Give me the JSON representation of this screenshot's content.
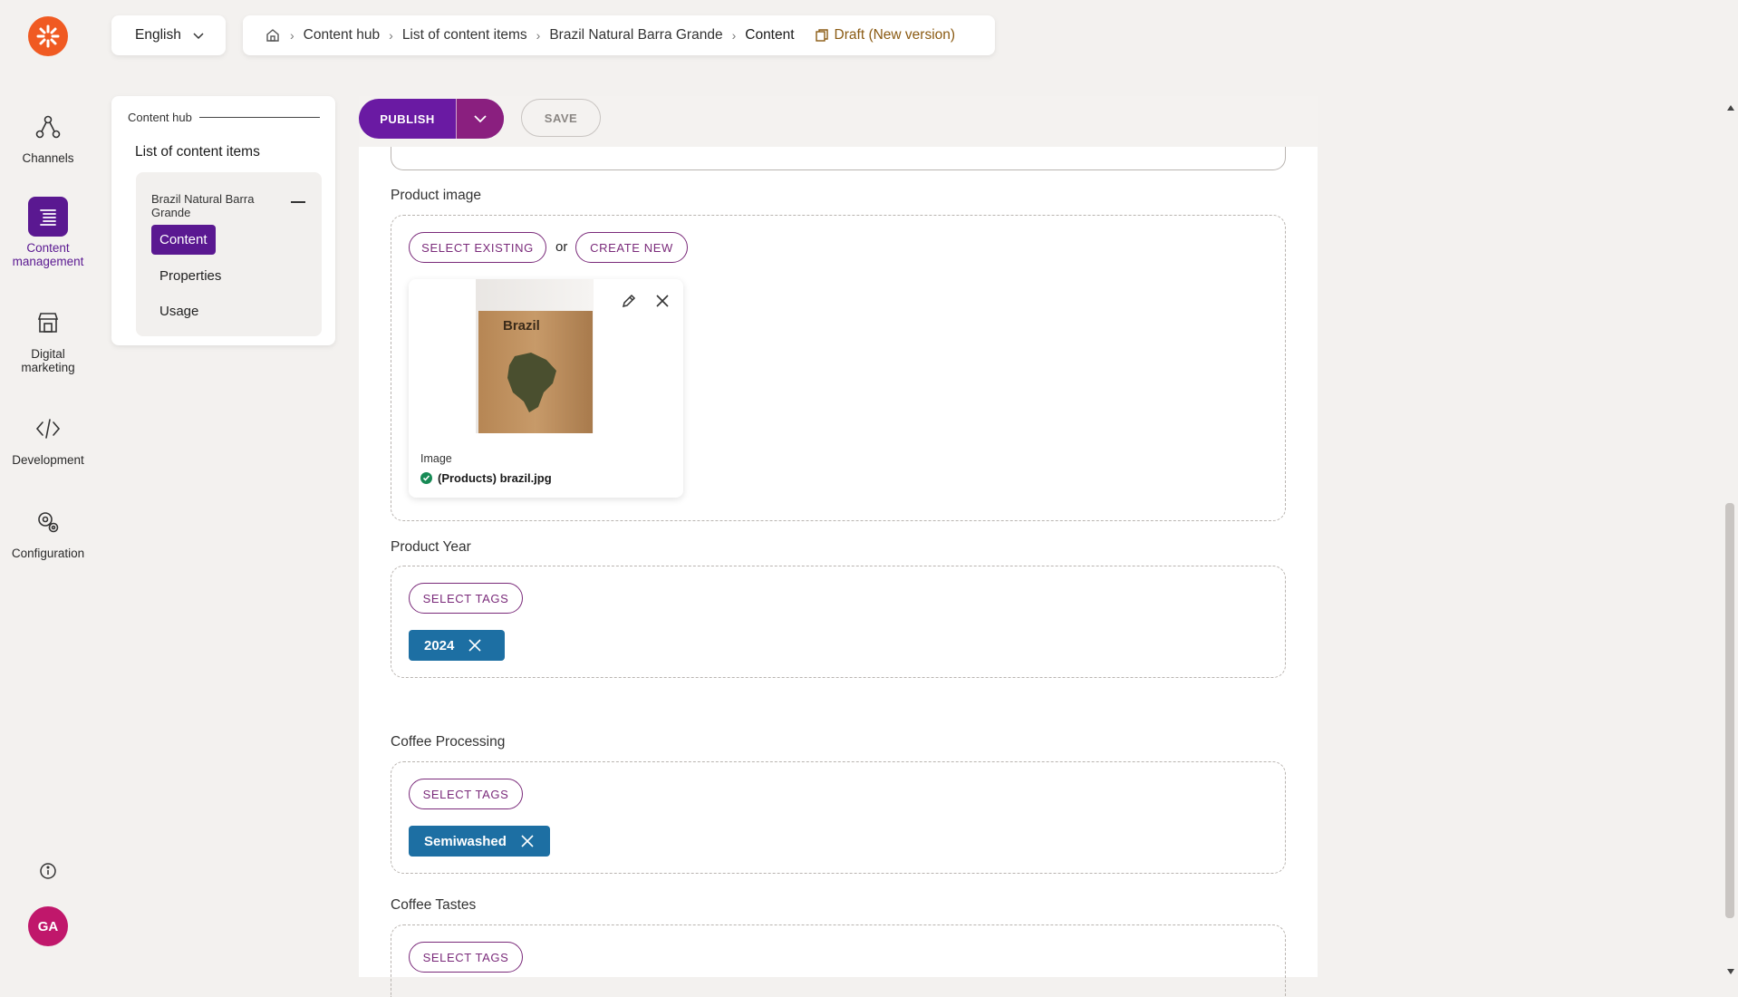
{
  "nav": {
    "items": [
      {
        "label": "Channels",
        "icon": "channels-icon"
      },
      {
        "label": "Content management",
        "icon": "content-management-icon",
        "active": true
      },
      {
        "label": "Digital marketing",
        "icon": "store-icon"
      },
      {
        "label": "Development",
        "icon": "code-icon"
      },
      {
        "label": "Configuration",
        "icon": "gear-icon"
      }
    ],
    "avatar": "GA"
  },
  "language": {
    "selected": "English"
  },
  "breadcrumb": {
    "items": [
      "Content hub",
      "List of content items",
      "Brazil Natural Barra Grande",
      "Content"
    ],
    "status": "Draft (New version)"
  },
  "tree": {
    "hub": "Content hub",
    "list": "List of content items",
    "node": "Brazil Natural Barra Grande",
    "subitems": [
      "Content",
      "Properties",
      "Usage"
    ]
  },
  "toolbar": {
    "publish": "PUBLISH",
    "save": "SAVE"
  },
  "fields": {
    "product_image": {
      "label": "Product image",
      "select_existing": "SELECT EXISTING",
      "or": "or",
      "create_new": "CREATE NEW",
      "image_text": "Brazil",
      "caption_type": "Image",
      "filename": "(Products) brazil.jpg"
    },
    "product_year": {
      "label": "Product Year",
      "select": "SELECT TAGS",
      "tag": "2024"
    },
    "coffee_processing": {
      "label": "Coffee Processing",
      "select": "SELECT TAGS",
      "tag": "Semiwashed"
    },
    "coffee_tastes": {
      "label": "Coffee Tastes",
      "select": "SELECT TAGS"
    }
  },
  "colors": {
    "brand": "#f05a22",
    "accent": "#5a1891",
    "tag": "#1d6fa3",
    "draft": "#8a5a12"
  }
}
